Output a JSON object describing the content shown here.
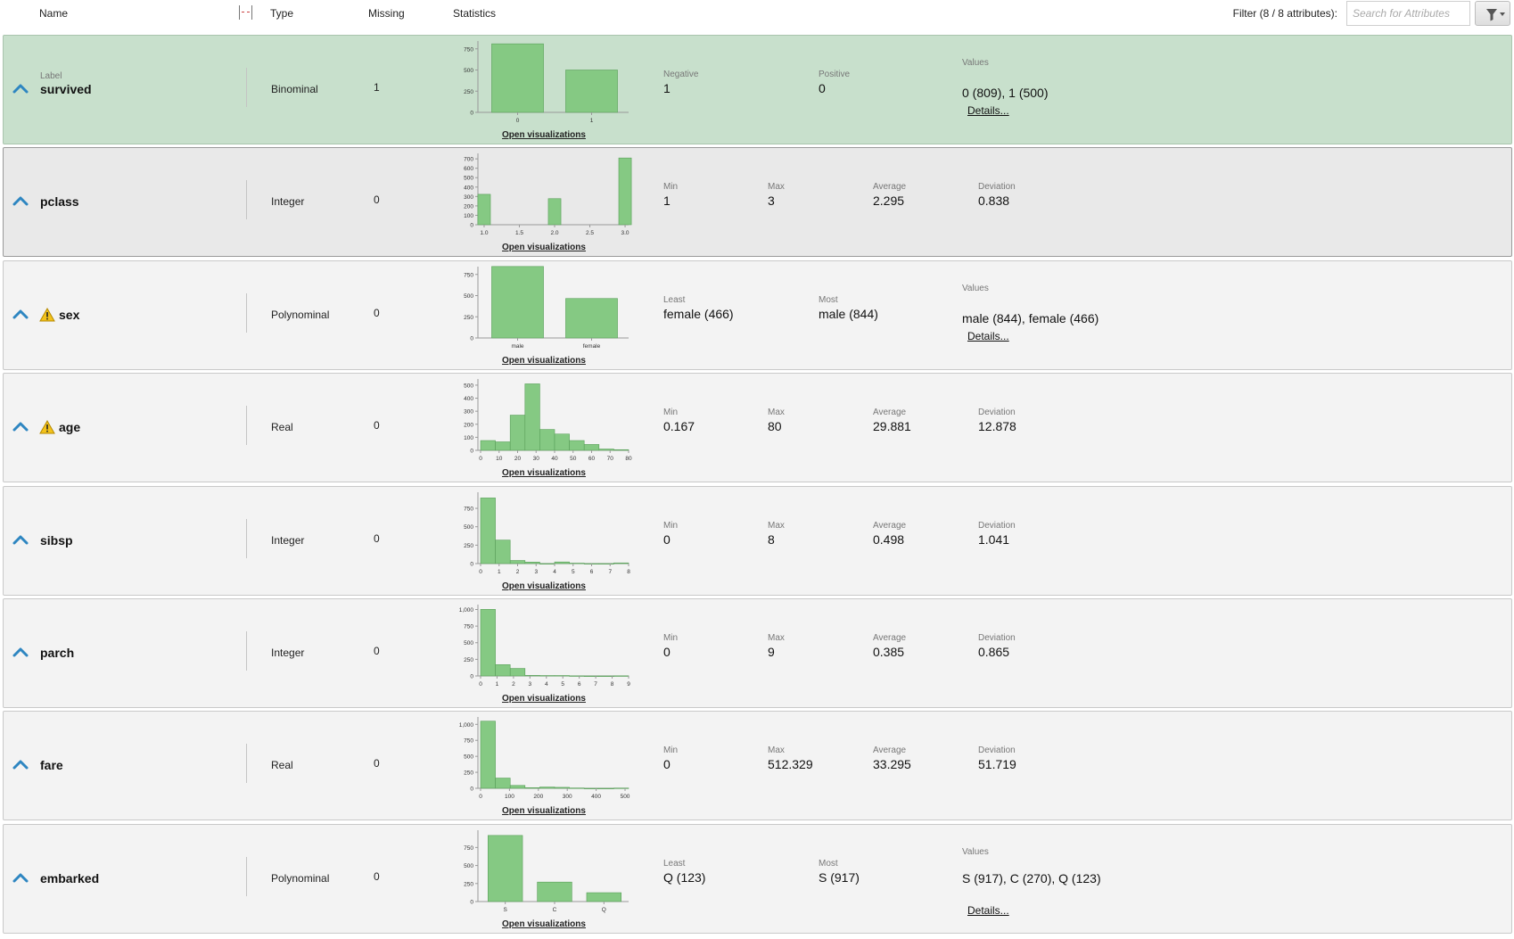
{
  "header": {
    "col_name": "Name",
    "col_type": "Type",
    "col_missing": "Missing",
    "col_statistics": "Statistics",
    "filter_label": "Filter (8 / 8 attributes):",
    "search_placeholder": "Search for Attributes",
    "filter_button_icon": "funnel-dropdown-icon"
  },
  "colors": {
    "bar_fill": "#85c983",
    "bar_stroke": "#5aa05a",
    "selected_row": "#c8e0cc",
    "collapse_icon": "#2e86c1",
    "warning": "#f3c21b"
  },
  "open_visualizations_label": "Open visualizations",
  "details_label": "Details...",
  "rows": [
    {
      "name": "survived",
      "role": "Label",
      "type": "Binominal",
      "missing": "1",
      "warning": false,
      "stats": [
        {
          "label": "Negative",
          "value": "1"
        },
        {
          "label": "Positive",
          "value": "0"
        }
      ],
      "values_label": "Values",
      "values": "0 (809), 1 (500)"
    },
    {
      "name": "pclass",
      "role": "",
      "type": "Integer",
      "missing": "0",
      "warning": false,
      "stats": [
        {
          "label": "Min",
          "value": "1"
        },
        {
          "label": "Max",
          "value": "3"
        },
        {
          "label": "Average",
          "value": "2.295"
        },
        {
          "label": "Deviation",
          "value": "0.838"
        }
      ]
    },
    {
      "name": "sex",
      "role": "",
      "type": "Polynominal",
      "missing": "0",
      "warning": true,
      "stats": [
        {
          "label": "Least",
          "value": "female (466)"
        },
        {
          "label": "Most",
          "value": "male (844)"
        }
      ],
      "values_label": "Values",
      "values": "male (844), female (466)"
    },
    {
      "name": "age",
      "role": "",
      "type": "Real",
      "missing": "0",
      "warning": true,
      "stats": [
        {
          "label": "Min",
          "value": "0.167"
        },
        {
          "label": "Max",
          "value": "80"
        },
        {
          "label": "Average",
          "value": "29.881"
        },
        {
          "label": "Deviation",
          "value": "12.878"
        }
      ]
    },
    {
      "name": "sibsp",
      "role": "",
      "type": "Integer",
      "missing": "0",
      "warning": false,
      "stats": [
        {
          "label": "Min",
          "value": "0"
        },
        {
          "label": "Max",
          "value": "8"
        },
        {
          "label": "Average",
          "value": "0.498"
        },
        {
          "label": "Deviation",
          "value": "1.041"
        }
      ]
    },
    {
      "name": "parch",
      "role": "",
      "type": "Integer",
      "missing": "0",
      "warning": false,
      "stats": [
        {
          "label": "Min",
          "value": "0"
        },
        {
          "label": "Max",
          "value": "9"
        },
        {
          "label": "Average",
          "value": "0.385"
        },
        {
          "label": "Deviation",
          "value": "0.865"
        }
      ]
    },
    {
      "name": "fare",
      "role": "",
      "type": "Real",
      "missing": "0",
      "warning": false,
      "stats": [
        {
          "label": "Min",
          "value": "0"
        },
        {
          "label": "Max",
          "value": "512.329"
        },
        {
          "label": "Average",
          "value": "33.295"
        },
        {
          "label": "Deviation",
          "value": "51.719"
        }
      ]
    },
    {
      "name": "embarked",
      "role": "",
      "type": "Polynominal",
      "missing": "0",
      "warning": false,
      "stats": [
        {
          "label": "Least",
          "value": "Q (123)"
        },
        {
          "label": "Most",
          "value": "S (917)"
        }
      ],
      "values_label": "Values",
      "values": "S (917), C (270), Q (123)"
    }
  ],
  "chart_data": [
    {
      "attribute": "survived",
      "type": "bar",
      "categories": [
        "0",
        "1"
      ],
      "values": [
        809,
        500
      ],
      "ylim": [
        0,
        800
      ],
      "yticks": [
        "0",
        "250",
        "500",
        "750"
      ],
      "xticks": [
        "0",
        "1"
      ]
    },
    {
      "attribute": "pclass",
      "type": "bar",
      "x": [
        1.0,
        2.0,
        3.0
      ],
      "values": [
        323,
        277,
        709
      ],
      "xlim": [
        0.95,
        3.05
      ],
      "ylim": [
        0,
        720
      ],
      "yticks": [
        "0",
        "100",
        "200",
        "300",
        "400",
        "500",
        "600",
        "700"
      ],
      "xticks": [
        "1.0",
        "1.5",
        "2.0",
        "2.5",
        "3.0"
      ]
    },
    {
      "attribute": "sex",
      "type": "bar",
      "categories": [
        "male",
        "female"
      ],
      "values": [
        844,
        466
      ],
      "ylim": [
        0,
        800
      ],
      "yticks": [
        "0",
        "250",
        "500",
        "750"
      ],
      "xticks": [
        "male",
        "female"
      ]
    },
    {
      "attribute": "age",
      "type": "bar",
      "bin_edges": [
        0,
        8,
        16,
        24,
        32,
        40,
        48,
        56,
        64,
        72,
        80
      ],
      "values": [
        75,
        65,
        270,
        510,
        160,
        125,
        75,
        45,
        10,
        5
      ],
      "xlim": [
        0,
        80
      ],
      "ylim": [
        0,
        520
      ],
      "yticks": [
        "0",
        "100",
        "200",
        "300",
        "400",
        "500"
      ],
      "xticks": [
        "0",
        "10",
        "20",
        "30",
        "40",
        "50",
        "60",
        "70",
        "80"
      ]
    },
    {
      "attribute": "sibsp",
      "type": "bar",
      "bin_edges": [
        0,
        0.8,
        1.6,
        2.4,
        3.2,
        4.0,
        4.8,
        5.6,
        6.4,
        7.2,
        8.0
      ],
      "values": [
        891,
        319,
        42,
        20,
        0,
        22,
        6,
        0,
        0,
        9
      ],
      "xlim": [
        0,
        8
      ],
      "ylim": [
        0,
        920
      ],
      "yticks": [
        "0",
        "250",
        "500",
        "750"
      ],
      "xticks": [
        "0",
        "1",
        "2",
        "3",
        "4",
        "5",
        "6",
        "7",
        "8"
      ]
    },
    {
      "attribute": "parch",
      "type": "bar",
      "bin_edges": [
        0,
        0.9,
        1.8,
        2.7,
        3.6,
        4.5,
        5.4,
        6.3,
        7.2,
        8.1,
        9.0
      ],
      "values": [
        1002,
        170,
        113,
        8,
        6,
        6,
        2,
        0,
        0,
        2
      ],
      "xlim": [
        0,
        9
      ],
      "ylim": [
        0,
        1020
      ],
      "yticks": [
        "0",
        "250",
        "500",
        "750",
        "1,000"
      ],
      "xticks": [
        "0",
        "1",
        "2",
        "3",
        "4",
        "5",
        "6",
        "7",
        "8",
        "9"
      ]
    },
    {
      "attribute": "fare",
      "type": "bar",
      "bin_edges": [
        0,
        51.2,
        102.5,
        153.7,
        204.9,
        256.2,
        307.4,
        358.6,
        409.9,
        461.1,
        512.3
      ],
      "values": [
        1050,
        160,
        45,
        10,
        20,
        15,
        5,
        0,
        0,
        4
      ],
      "xlim": [
        0,
        512.3
      ],
      "ylim": [
        0,
        1060
      ],
      "yticks": [
        "0",
        "250",
        "500",
        "750",
        "1,000"
      ],
      "xticks": [
        "0",
        "100",
        "200",
        "300",
        "400",
        "500"
      ]
    },
    {
      "attribute": "embarked",
      "type": "bar",
      "categories": [
        "S",
        "C",
        "Q"
      ],
      "values": [
        917,
        270,
        123
      ],
      "ylim": [
        0,
        940
      ],
      "yticks": [
        "0",
        "250",
        "500",
        "750"
      ],
      "xticks": [
        "S",
        "C",
        "Q"
      ]
    }
  ]
}
